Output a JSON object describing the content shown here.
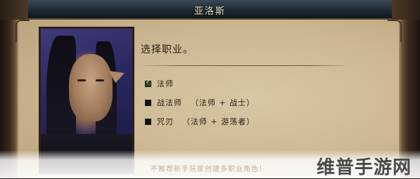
{
  "window": {
    "title": "亚洛斯"
  },
  "prompt": "选择职业。",
  "options": [
    {
      "label": "法师",
      "sub": "",
      "checked": true
    },
    {
      "label": "战法师",
      "sub": "（法师 + 战士）",
      "checked": false
    },
    {
      "label": "咒刃",
      "sub": "（法师 + 游荡者）",
      "checked": false
    }
  ],
  "footer_hint": "不推荐新手玩家创建多职业角色！",
  "watermark": "维普手游网",
  "colors": {
    "title_bar": "#1d2a32",
    "parchment": "#cdb994",
    "text": "#2a1d12",
    "checked": "#2f4a2a"
  }
}
